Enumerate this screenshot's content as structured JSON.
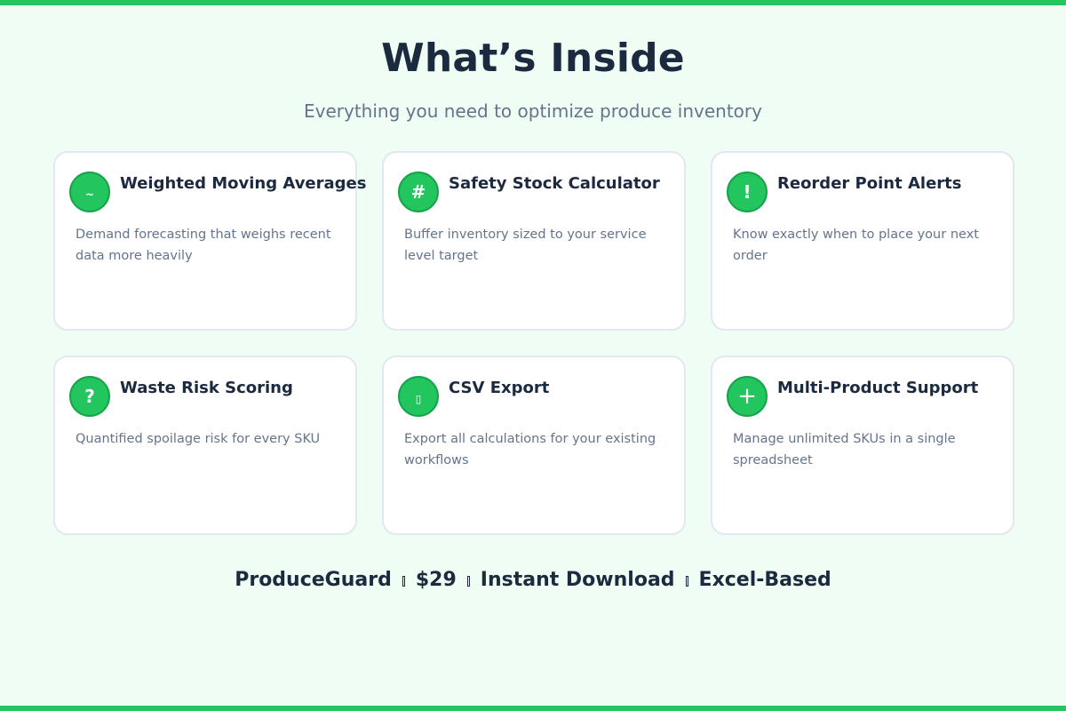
{
  "page": {
    "title": "What’s Inside",
    "subtitle": "Everything you need to optimize produce inventory"
  },
  "colors": {
    "accent": "#22c55e",
    "background": "#effdf4",
    "heading": "#1c2a3f",
    "muted": "#64748b"
  },
  "features": [
    {
      "icon": "tilde-icon",
      "glyph": "~",
      "title": "Weighted Moving Averages",
      "description": "Demand forecasting that weighs recent data more heavily"
    },
    {
      "icon": "hash-icon",
      "glyph": "#",
      "title": "Safety Stock Calculator",
      "description": "Buffer inventory sized to your service level target"
    },
    {
      "icon": "exclamation-icon",
      "glyph": "!",
      "title": "Reorder Point Alerts",
      "description": "Know exactly when to place your next order"
    },
    {
      "icon": "question-icon",
      "glyph": "?",
      "title": "Waste Risk Scoring",
      "description": "Quantified spoilage risk for every SKU"
    },
    {
      "icon": "bar-icon",
      "glyph": "▯",
      "title": "CSV Export",
      "description": "Export all calculations for your existing workflows"
    },
    {
      "icon": "plus-icon",
      "glyph": "+",
      "title": "Multi-Product Support",
      "description": "Manage unlimited SKUs in a single spreadsheet"
    }
  ],
  "footer": {
    "brand": "ProduceGuard",
    "price": "$29",
    "delivery": "Instant Download",
    "platform": "Excel-Based"
  }
}
